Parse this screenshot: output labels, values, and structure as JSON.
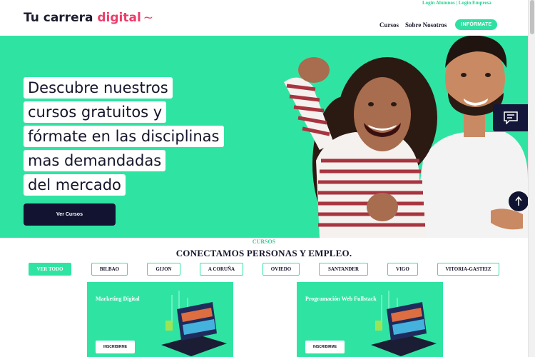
{
  "header": {
    "logo_main": "Tu carrera ",
    "logo_accent": "digital",
    "logo_tilde": "~",
    "login_alumnos": "Login Alumnos",
    "login_separator": " | ",
    "login_empresa": "Login Empresa",
    "nav_cursos": "Cursos",
    "nav_sobre": "Sobre Nosotros",
    "nav_cta": "INFÓRMATE"
  },
  "hero": {
    "lines": [
      "Descubre nuestros",
      "cursos gratuitos y",
      "fórmate en las disciplinas",
      "mas demandadas",
      "del mercado"
    ],
    "button": "Ver Cursos"
  },
  "section": {
    "tag": "CURSOS",
    "title": "CONECTAMOS PERSONAS Y EMPLEO."
  },
  "filters": [
    "VER TODO",
    "BILBAO",
    "GIJON",
    "A CORUÑA",
    "OVIEDO",
    "SANTANDER",
    "VIGO",
    "VITORIA-GASTEIZ"
  ],
  "active_filter": "VER TODO",
  "cards": [
    {
      "title": "Marketing Digital",
      "button": "INSCRIBIRME"
    },
    {
      "title": "Programación Web Fullstack",
      "button": "INSCRIBIRME"
    }
  ],
  "colors": {
    "accent_green": "#2fe4a3",
    "accent_pink": "#ee3d6a",
    "dark_navy": "#111330"
  }
}
